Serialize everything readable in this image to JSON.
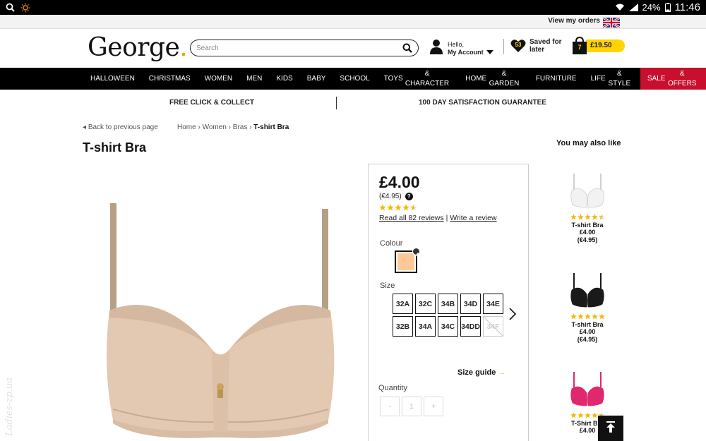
{
  "status_bar": {
    "battery": "24%",
    "time": "11:46",
    "icons": [
      "search-icon",
      "brightness-icon",
      "wifi-icon",
      "signal-icon",
      "battery-icon"
    ]
  },
  "utility": {
    "view_orders": "View my orders",
    "flag": "uk-flag-icon"
  },
  "header": {
    "logo_text": "George",
    "logo_dot": ".",
    "search_placeholder": "Search",
    "account_hello": "Hello,",
    "account_label": "My Account",
    "saved_count": "53",
    "saved_line1": "Saved for",
    "saved_line2": "later",
    "basket_count": "7",
    "basket_total": "£19.50"
  },
  "nav": {
    "items": [
      {
        "line1": "HALLOWEEN",
        "line2": ""
      },
      {
        "line1": "CHRISTMAS",
        "line2": ""
      },
      {
        "line1": "WOMEN",
        "line2": ""
      },
      {
        "line1": "MEN",
        "line2": ""
      },
      {
        "line1": "KIDS",
        "line2": ""
      },
      {
        "line1": "BABY",
        "line2": ""
      },
      {
        "line1": "SCHOOL",
        "line2": ""
      },
      {
        "line1": "TOYS",
        "line2": "& CHARACTER"
      },
      {
        "line1": "HOME",
        "line2": "& GARDEN"
      },
      {
        "line1": "FURNITURE",
        "line2": ""
      },
      {
        "line1": "LIFE",
        "line2": "& STYLE"
      },
      {
        "line1": "SALE",
        "line2": "& OFFERS"
      }
    ]
  },
  "promo": {
    "left": "FREE CLICK & COLLECT",
    "right": "100 DAY SATISFACTION GUARANTEE"
  },
  "breadcrumb": {
    "back": "Back to previous page",
    "items": [
      "Home",
      "Women",
      "Bras"
    ],
    "current": "T-shirt Bra",
    "separator": "›"
  },
  "product": {
    "title": "T-shirt Bra",
    "price": "£4.00",
    "price_alt": "(€4.95)",
    "rating": 4.5,
    "reviews_link": "Read all 82 reviews",
    "review_sep": "|",
    "write_review": "Write a review",
    "colour_label": "Colour",
    "colour_hex": "#ffc896",
    "size_label": "Size",
    "sizes": [
      {
        "label": "32A",
        "available": true
      },
      {
        "label": "32C",
        "available": true
      },
      {
        "label": "34B",
        "available": true
      },
      {
        "label": "34D",
        "available": true
      },
      {
        "label": "34E",
        "available": true
      },
      {
        "label": "32B",
        "available": true
      },
      {
        "label": "34A",
        "available": true
      },
      {
        "label": "34C",
        "available": true
      },
      {
        "label": "34DD",
        "available": true
      },
      {
        "label": "34F",
        "available": false
      }
    ],
    "size_guide": "Size guide",
    "size_guide_arrow": "→",
    "quantity_label": "Quantity",
    "qty_minus": "-",
    "qty_value": "1",
    "qty_plus": "+"
  },
  "recommendations": {
    "title": "You may also like",
    "items": [
      {
        "name": "T-shirt Bra",
        "price": "£4.00",
        "price_alt": "(€4.95)",
        "colour": "#f2f2f2",
        "rating": 4.5
      },
      {
        "name": "T-shirt Bra",
        "price": "£4.00",
        "price_alt": "(€4.95)",
        "colour": "#1a1a1a",
        "rating": 5
      },
      {
        "name": "T-Shirt Bra",
        "price": "£4.00",
        "price_alt": "",
        "colour": "#e0286e",
        "rating": 4.5
      }
    ]
  },
  "colors": {
    "brand_yellow": "#ffd400",
    "nav_black": "#000000",
    "sale_red": "#c8102e",
    "star_yellow": "#f5b800",
    "product_nude": "#e3c9b2"
  },
  "watermark": "Ladies-zp.ua"
}
